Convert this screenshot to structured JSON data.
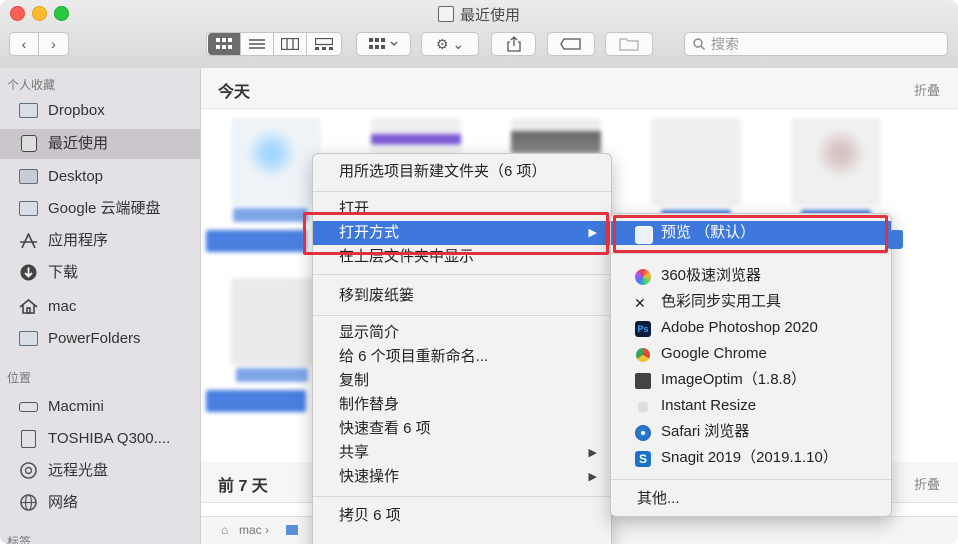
{
  "window": {
    "title": "最近使用"
  },
  "toolbar": {
    "back": "‹",
    "forward": "›",
    "gear": "⚙ ⌄",
    "share": "⇧",
    "search_placeholder": "搜索"
  },
  "sidebar": {
    "favorites_header": "个人收藏",
    "favorites": [
      {
        "label": "Dropbox"
      },
      {
        "label": "最近使用"
      },
      {
        "label": "Desktop"
      },
      {
        "label": "Google 云端硬盘"
      },
      {
        "label": "应用程序"
      },
      {
        "label": "下载"
      },
      {
        "label": "mac"
      },
      {
        "label": "PowerFolders"
      }
    ],
    "locations_header": "位置",
    "locations": [
      {
        "label": "Macmini"
      },
      {
        "label": "TOSHIBA Q300...."
      },
      {
        "label": "远程光盘"
      },
      {
        "label": "网络"
      }
    ],
    "tags_header": "标签"
  },
  "main": {
    "section_today": "今天",
    "section_week": "前 7 天",
    "fold_label": "折叠",
    "path": "mac ›"
  },
  "context_menu": {
    "items": [
      "用所选项目新建文件夹（6 项）",
      "打开",
      "打开方式",
      "在上层文件夹中显示",
      "移到废纸篓",
      "显示简介",
      "给 6 个项目重新命名...",
      "复制",
      "制作替身",
      "快速查看 6 项",
      "共享",
      "快速操作",
      "拷贝 6 项"
    ]
  },
  "open_with_menu": {
    "default_app": "预览 （默认）",
    "apps": [
      {
        "label": "360极速浏览器",
        "icon": "360-browser-icon",
        "color": "#e8424a"
      },
      {
        "label": "色彩同步实用工具",
        "icon": "colorsync-icon",
        "color": "#666666"
      },
      {
        "label": "Adobe Photoshop 2020",
        "icon": "photoshop-icon",
        "color": "#0b1d3b"
      },
      {
        "label": "Google Chrome",
        "icon": "chrome-icon",
        "color": "#de4c3c"
      },
      {
        "label": "ImageOptim（1.8.8）",
        "icon": "imageoptim-icon",
        "color": "#444444"
      },
      {
        "label": "Instant Resize",
        "icon": "instant-resize-icon",
        "color": "#cccccc"
      },
      {
        "label": "Safari 浏览器",
        "icon": "safari-icon",
        "color": "#2f80d8"
      },
      {
        "label": "Snagit 2019（2019.1.10）",
        "icon": "snagit-icon",
        "color": "#1a73c8"
      }
    ],
    "other": "其他..."
  },
  "colors": {
    "highlight": "#3f78dd",
    "annotation": "#e2303f"
  }
}
